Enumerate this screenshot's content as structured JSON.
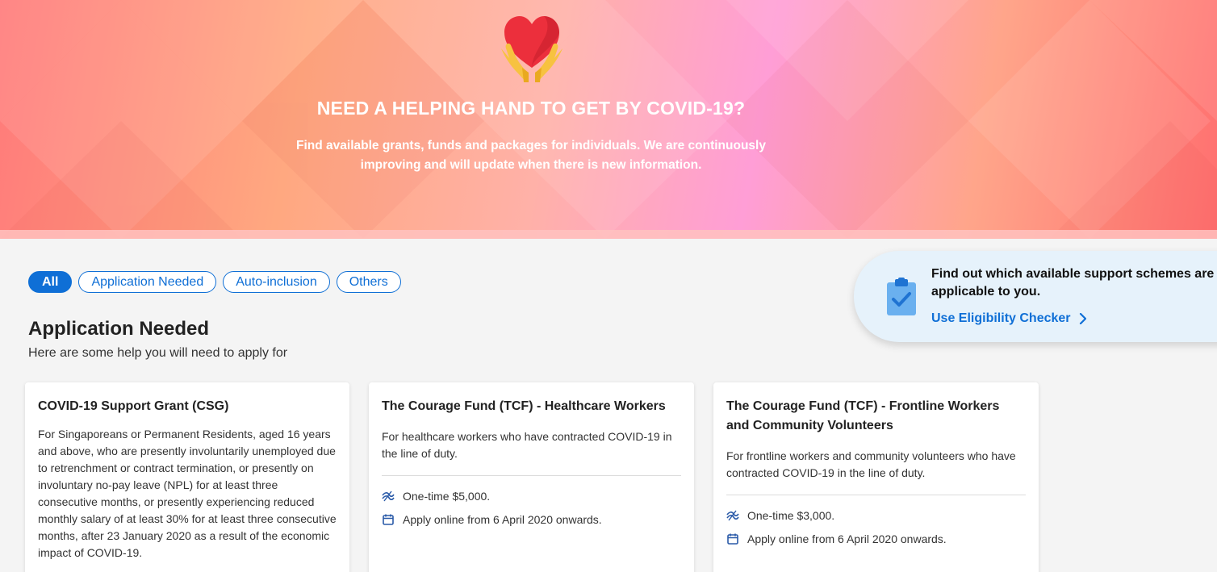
{
  "hero": {
    "title": "NEED A HELPING HAND TO GET BY COVID-19?",
    "subtitle": "Find available grants, funds and packages for individuals. We are continuously improving and will update when there is new information."
  },
  "filters": [
    "All",
    "Application Needed",
    "Auto-inclusion",
    "Others"
  ],
  "section": {
    "title": "Application Needed",
    "subtitle": "Here are some help you will need to apply for"
  },
  "eligibility": {
    "text": "Find out which available support schemes are applicable to you.",
    "link": "Use Eligibility Checker"
  },
  "cards": [
    {
      "title": "COVID-19 Support Grant (CSG)",
      "description": "For Singaporeans or Permanent Residents, aged 16 years and above, who are presently involuntarily unemployed due to retrenchment or contract termination, or presently on involuntary no-pay leave (NPL) for at least three consecutive months, or presently experiencing reduced monthly salary of at least 30% for at least three consecutive months, after 23 January 2020 as a result of the economic impact of COVID-19."
    },
    {
      "title": "The Courage Fund (TCF) - Healthcare Workers",
      "description": "For healthcare workers who have contracted COVID-19 in the line of duty.",
      "amount": "One-time $5,000.",
      "apply": "Apply online from 6 April 2020 onwards."
    },
    {
      "title": "The Courage Fund (TCF) - Frontline Workers and Community Volunteers",
      "description": "For frontline workers and community volunteers who have contracted COVID-19 in the line of duty.",
      "amount": "One-time $3,000.",
      "apply": "Apply online from 6 April 2020 onwards."
    }
  ],
  "icons": {
    "hero": "heart-hands-icon",
    "eligibility": "clipboard-check-icon",
    "link": "chevron-right-icon",
    "amount": "money-icon",
    "date": "calendar-icon"
  },
  "colors": {
    "accent": "#0f6fd6",
    "hero_start": "#ff7a7a",
    "hero_mid": "#ff9ed6",
    "hero_end": "#ff6f6f",
    "eligibility_bg": "#e6f2fb"
  }
}
